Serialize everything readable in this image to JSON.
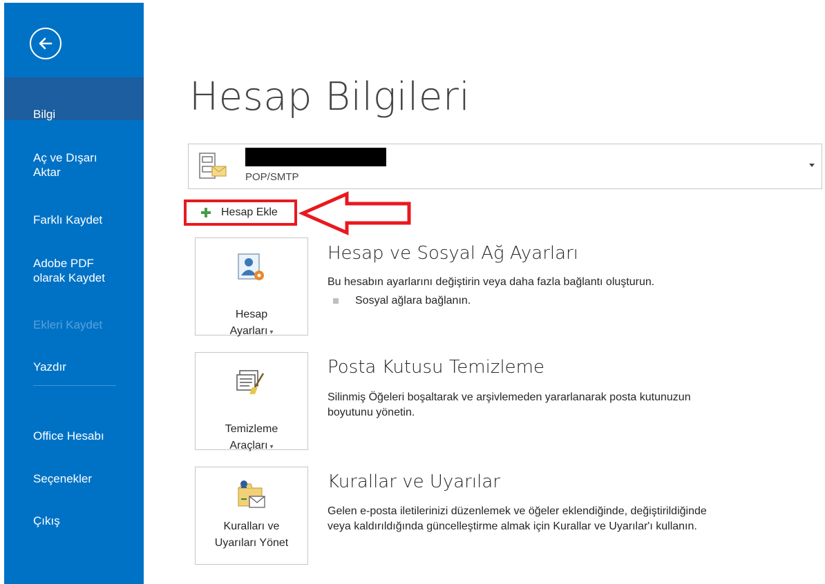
{
  "sidebar": {
    "items": [
      {
        "label": "Bilgi"
      },
      {
        "label": "Aç ve Dışarı\nAktar"
      },
      {
        "label": "Farklı Kaydet"
      },
      {
        "label": "Adobe PDF\nolarak Kaydet"
      },
      {
        "label": "Ekleri Kaydet"
      },
      {
        "label": "Yazdır"
      },
      {
        "label": "Office Hesabı"
      },
      {
        "label": "Seçenekler"
      },
      {
        "label": "Çıkış"
      }
    ]
  },
  "main": {
    "title": "Hesap Bilgileri",
    "account": {
      "type": "POP/SMTP"
    },
    "add_account_label": "Hesap Ekle",
    "sections": [
      {
        "tile_label": "Hesap\nAyarları",
        "heading": "Hesap ve Sosyal Ağ Ayarları",
        "description": "Bu hesabın ayarlarını değiştirin veya daha fazla bağlantı oluşturun.",
        "bullet": "Sosyal ağlara bağlanın."
      },
      {
        "tile_label": "Temizleme\nAraçları",
        "heading": "Posta Kutusu Temizleme",
        "description": "Silinmiş Öğeleri boşaltarak ve arşivlemeden yararlanarak posta kutunuzun\nboyutunu yönetin."
      },
      {
        "tile_label": "Kuralları ve\nUyarıları Yönet",
        "heading": "Kurallar ve Uyarılar",
        "description": "Gelen e-posta iletilerinizi düzenlemek ve öğeler eklendiğinde, değiştirildiğinde\nveya kaldırıldığında güncelleştirme almak için Kurallar ve Uyarılar'ı kullanın."
      }
    ]
  },
  "colors": {
    "sidebar": "#0072c6",
    "sidebar_active": "#1c5e9f",
    "highlight": "#e8191f"
  },
  "icons": [
    "back-arrow-icon",
    "account-icon",
    "plus-icon",
    "account-settings-icon",
    "cleanup-tools-icon",
    "rules-alerts-icon",
    "chevron-down-icon"
  ]
}
